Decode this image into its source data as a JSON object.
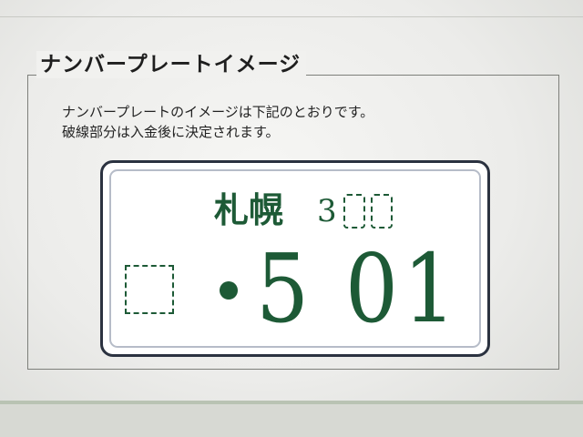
{
  "section": {
    "title": "ナンバープレートイメージ",
    "description_line1": "ナンバープレートのイメージは下記のとおりです。",
    "description_line2": "破線部分は入金後に決定されます。"
  },
  "plate": {
    "region": "札幌",
    "class_number_prefix": "3",
    "serial_number": "5 01",
    "colors": {
      "text": "#1d5a36",
      "border": "#2b3240",
      "background": "#ffffff"
    }
  }
}
